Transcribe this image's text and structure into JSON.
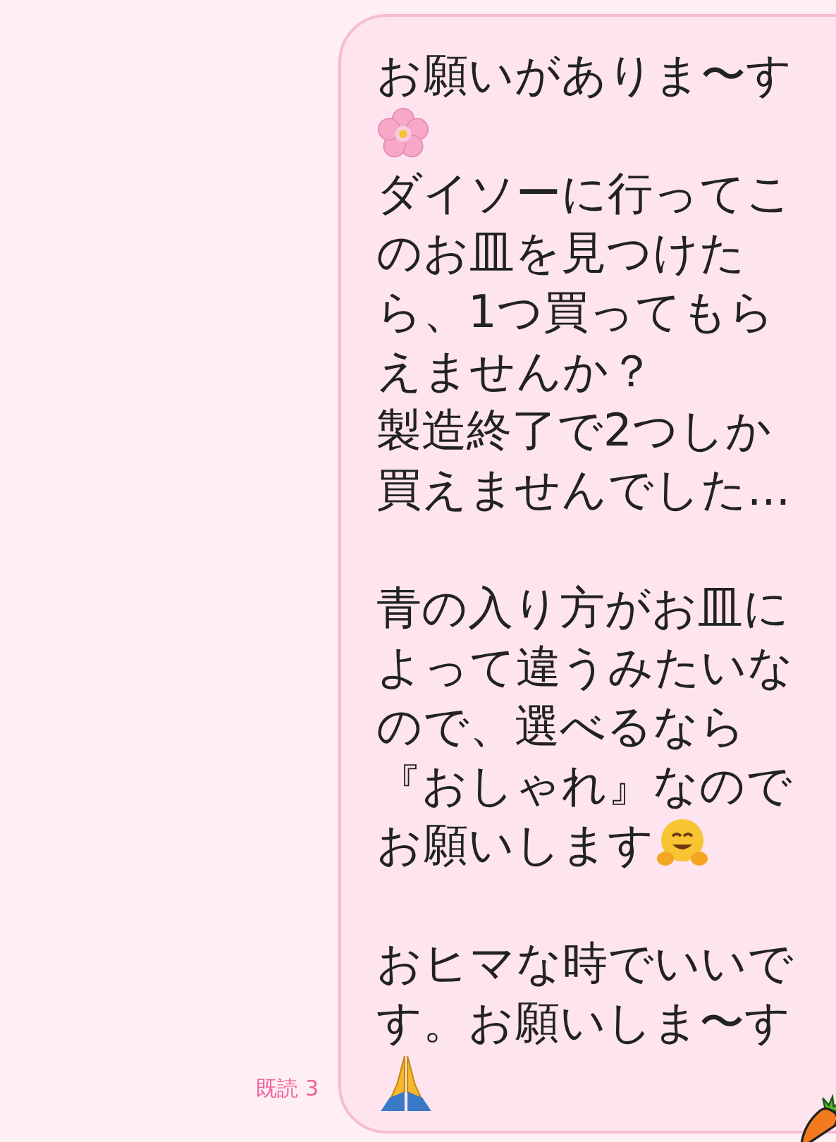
{
  "message": {
    "paragraphs": [
      {
        "parts": [
          {
            "kind": "text",
            "text": "お願いがありま〜す"
          },
          {
            "kind": "flower"
          },
          {
            "kind": "break"
          },
          {
            "kind": "text",
            "text": "ダイソーに行ってこのお皿を見つけたら、1つ買ってもらえませんか？"
          },
          {
            "kind": "break"
          },
          {
            "kind": "text",
            "text": "製造終了で2つしか買えませんでした..."
          }
        ]
      },
      {
        "parts": [
          {
            "kind": "text",
            "text": "青の入り方がお皿によって違うみたいなので、選べるなら『おしゃれ』なので"
          },
          {
            "kind": "break"
          },
          {
            "kind": "text",
            "text": "お願いします"
          },
          {
            "kind": "hug"
          }
        ]
      },
      {
        "parts": [
          {
            "kind": "text",
            "text": "おヒマな時でいいです。お願いしま〜す"
          },
          {
            "kind": "pray"
          }
        ]
      }
    ],
    "read_receipt": "既読 3"
  }
}
